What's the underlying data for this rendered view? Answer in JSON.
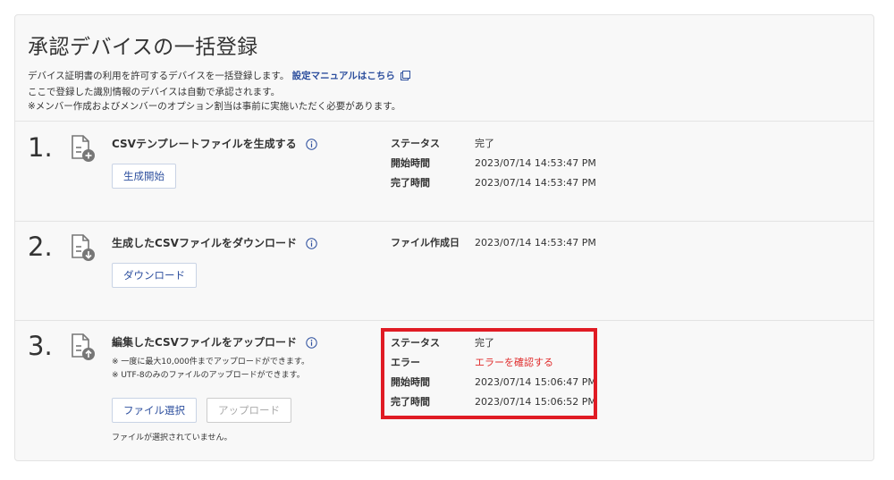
{
  "page": {
    "title": "承認デバイスの一括登録",
    "description": {
      "line1": "デバイス証明書の利用を許可するデバイスを一括登録します。",
      "link": "設定マニュアルはこちら",
      "line2": "ここで登録した識別情報のデバイスは自動で承認されます。",
      "line3": "※メンバー作成およびメンバーのオプション割当は事前に実施いただく必要があります。"
    }
  },
  "steps": [
    {
      "number": "1.",
      "title": "CSVテンプレートファイルを生成する",
      "button": "生成開始",
      "status": [
        {
          "label": "ステータス",
          "value": "完了"
        },
        {
          "label": "開始時間",
          "value": "2023/07/14 14:53:47 PM"
        },
        {
          "label": "完了時間",
          "value": "2023/07/14 14:53:47 PM"
        }
      ]
    },
    {
      "number": "2.",
      "title": "生成したCSVファイルをダウンロード",
      "button": "ダウンロード",
      "status": [
        {
          "label": "ファイル作成日",
          "value": "2023/07/14 14:53:47 PM"
        }
      ]
    },
    {
      "number": "3.",
      "title": "編集したCSVファイルをアップロード",
      "notes": [
        "※ 一度に最大10,000件までアップロードができます。",
        "※ UTF-8のみのファイルのアップロードができます。"
      ],
      "select_button": "ファイル選択",
      "upload_button": "アップロード",
      "no_file": "ファイルが選択されていません。",
      "status": [
        {
          "label": "ステータス",
          "value": "完了"
        },
        {
          "label": "エラー",
          "value": "エラーを確認する"
        },
        {
          "label": "開始時間",
          "value": "2023/07/14 15:06:47 PM"
        },
        {
          "label": "完了時間",
          "value": "2023/07/14 15:06:52 PM"
        }
      ]
    }
  ],
  "colors": {
    "accent": "#2d4f9e",
    "error": "#e02b2b",
    "highlight": "#e01b24"
  }
}
